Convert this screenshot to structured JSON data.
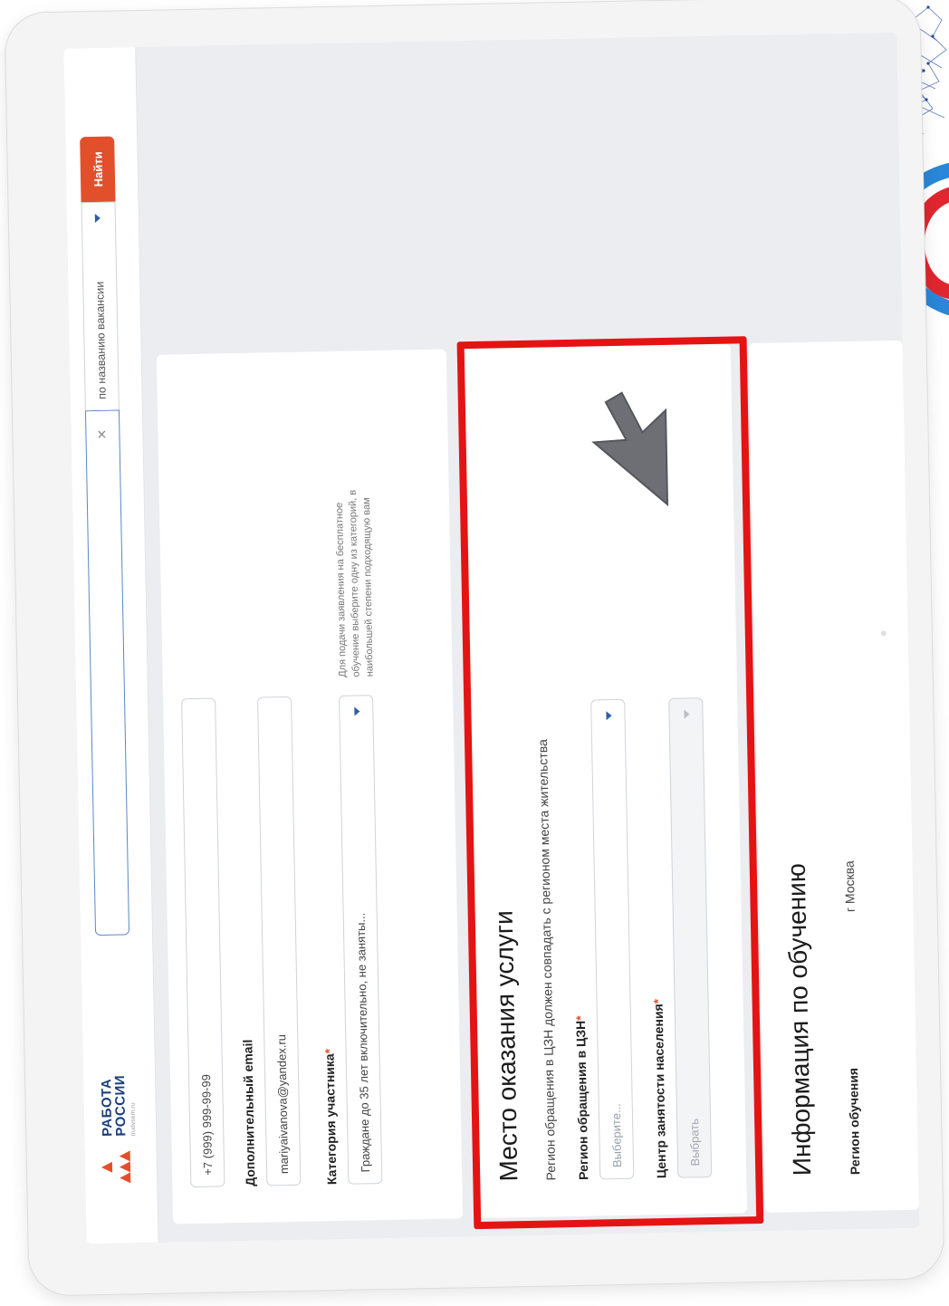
{
  "header": {
    "logo": {
      "line1": "РАБОТА",
      "line2": "РОССИИ",
      "sub": "trudvsem.ru"
    },
    "search": {
      "value": "",
      "placeholder": ""
    },
    "search_type": "по названию вакансии",
    "find_label": "Найти"
  },
  "contact": {
    "phone": "+7 (999) 999-99-99",
    "email_label": "Дополнительный email",
    "email_value": "mariyaivanova@yandex.ru",
    "category_label": "Категория участника",
    "category_value": "Граждане до 35 лет включительно, не заняты...",
    "category_hint": "Для подачи заявления на бесплатное обучение выберите одну из категорий, в наибольшей степени подходящую вам"
  },
  "service": {
    "title": "Место оказания услуги",
    "note": "Регион обращения в ЦЗН должен совпадать с регионом места жительства",
    "region_label": "Регион обращения в ЦЗН",
    "region_placeholder": "Выберите...",
    "center_label": "Центр занятости населения",
    "center_placeholder": "Выбрать"
  },
  "training": {
    "title": "Информация по обучению",
    "region_label": "Регион обучения",
    "region_value": "г Москва"
  },
  "required_mark": "*",
  "clear_icon": "×",
  "colors": {
    "brand_blue": "#1c3f7b",
    "accent_orange": "#e2502b",
    "highlight_red": "#e41414",
    "screen_bg": "#ecedf1"
  }
}
